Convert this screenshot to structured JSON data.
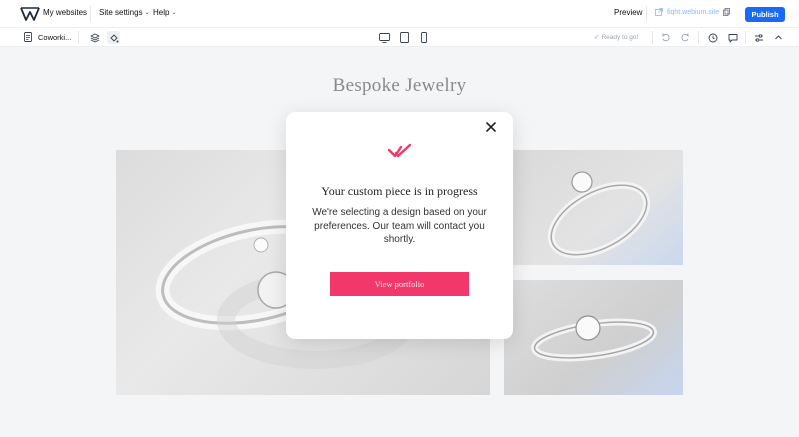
{
  "header": {
    "my_websites": "My websites",
    "site_settings": "Site settings",
    "help": "Help",
    "preview": "Preview",
    "site_url": "fiqht.webium.site",
    "publish": "Publish"
  },
  "toolbar": {
    "page_name": "Coworki...",
    "ready_status": "Ready to go!"
  },
  "page": {
    "section_title": "Bespoke Jewelry"
  },
  "modal": {
    "title": "Your custom piece is in progress",
    "text": "We're selecting a design based on your preferences. Our team will contact you shortly.",
    "button": "View portfolio"
  },
  "colors": {
    "accent": "#f2376a",
    "publish": "#1a6af5",
    "canvas_bg": "#f4f5f7"
  },
  "icons": [
    "logo-icon",
    "page-icon",
    "layers-icon",
    "paint-icon",
    "desktop-icon",
    "tablet-icon",
    "mobile-icon",
    "check-icon",
    "undo-icon",
    "redo-icon",
    "history-icon",
    "comment-icon",
    "sliders-icon",
    "collapse-icon",
    "copy-icon",
    "external-link-icon",
    "close-icon",
    "success-icon"
  ]
}
